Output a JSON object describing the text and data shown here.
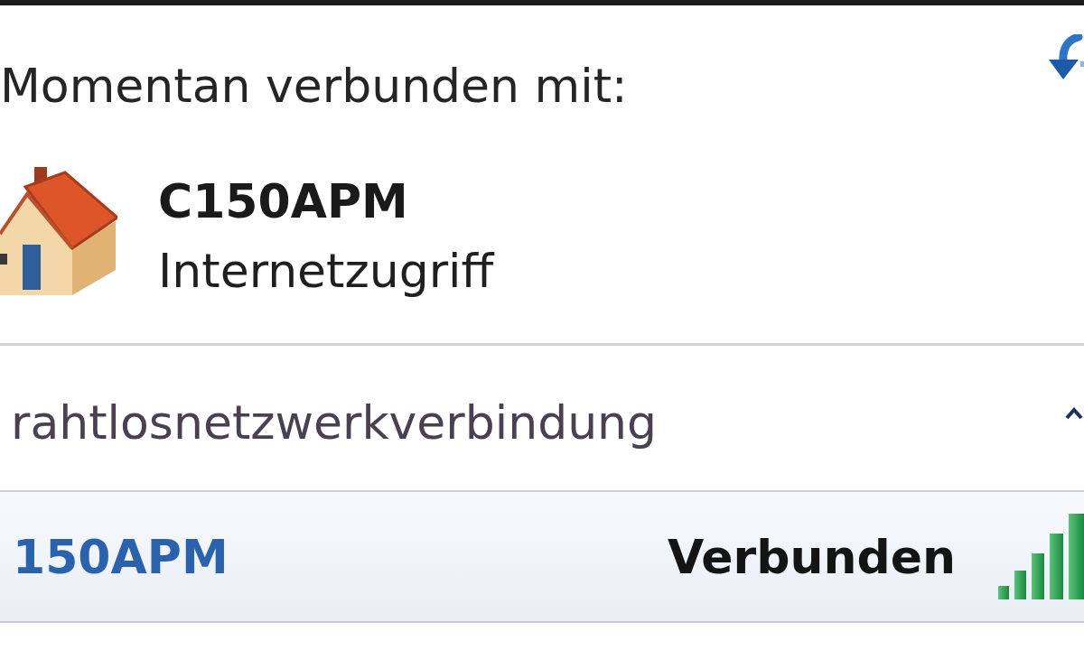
{
  "header": {
    "title": "Momentan verbunden mit:"
  },
  "current_network": {
    "name": "C150APM",
    "status": "Internetzugriff"
  },
  "section": {
    "title": "rahtlosnetzwerkverbindung",
    "expanded": true
  },
  "networks": [
    {
      "name": "150APM",
      "status": "Verbunden",
      "selected": true
    }
  ]
}
